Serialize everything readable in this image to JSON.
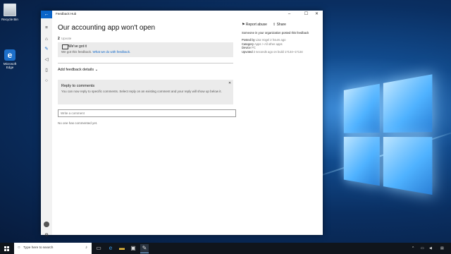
{
  "desktop": {
    "icons": [
      {
        "label": "Recycle Bin"
      },
      {
        "label": "Microsoft Edge",
        "glyph": "e"
      }
    ]
  },
  "window": {
    "app_title": "Feedback Hub",
    "back_glyph": "←",
    "controls": {
      "minimize": "–",
      "maximize": "☐",
      "close": "✕"
    }
  },
  "nav": {
    "icons": [
      "hamburger-icon",
      "home-icon",
      "feedback-icon",
      "announcements-icon",
      "quests-icon",
      "profile-icon",
      "settings-icon"
    ]
  },
  "feedback": {
    "title": "Our accounting app won't open",
    "upvote_count": "2",
    "upvote_label": "Upvote",
    "status": {
      "title": "We've got it",
      "text": "We got this feedback.",
      "link": "What we do with feedback."
    },
    "add_details": "Add feedback details",
    "reply": {
      "title": "Reply to comments",
      "text": "You can now reply to specific comments. Select reply on an existing comment and your reply will show up below it."
    },
    "comment_placeholder": "Write a comment",
    "no_comments": "No one has commented yet."
  },
  "sidebar": {
    "report_abuse": "Report abuse",
    "share": "Share",
    "org_line": "Someone in your organization posted this feedback",
    "meta": [
      {
        "label": "Posted by",
        "value": "Lisa Vogel 2 hours ago"
      },
      {
        "label": "Category",
        "value": "Apps > All other apps"
      },
      {
        "label": "Device",
        "value": "PC"
      },
      {
        "label": "Upvoted",
        "value": "2 seconds ago on build 17134~17134"
      }
    ]
  },
  "taskbar": {
    "search_placeholder": "Type here to search"
  },
  "colors": {
    "accent": "#0a64c8",
    "taskbar": "#10151c"
  }
}
